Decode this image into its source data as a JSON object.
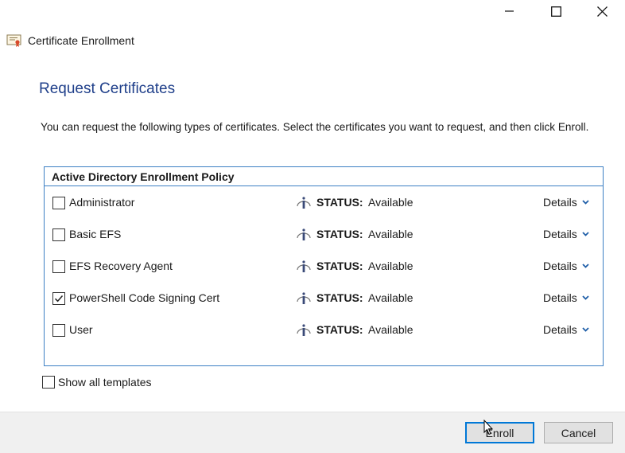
{
  "window": {
    "minimize_icon": "minimize-icon",
    "maximize_icon": "maximize-icon",
    "close_icon": "close-icon"
  },
  "header": {
    "title": "Certificate Enrollment",
    "icon": "certificate-icon"
  },
  "page": {
    "title": "Request Certificates",
    "instructions": "You can request the following types of certificates. Select the certificates you want to request, and then click Enroll."
  },
  "policy": {
    "title": "Active Directory Enrollment Policy",
    "status_label": "STATUS:",
    "details_label": "Details",
    "items": [
      {
        "name": "Administrator",
        "status": "Available",
        "checked": false
      },
      {
        "name": "Basic EFS",
        "status": "Available",
        "checked": false
      },
      {
        "name": "EFS Recovery Agent",
        "status": "Available",
        "checked": false
      },
      {
        "name": "PowerShell Code Signing Cert",
        "status": "Available",
        "checked": true
      },
      {
        "name": "User",
        "status": "Available",
        "checked": false
      }
    ]
  },
  "options": {
    "show_all_label": "Show all templates",
    "show_all_checked": false
  },
  "footer": {
    "enroll_label": "Enroll",
    "cancel_label": "Cancel"
  },
  "colors": {
    "title_blue": "#1f3f8a",
    "border_blue": "#3c7fc4",
    "focus_blue": "#0078d7",
    "footer_bg": "#f0f0f0"
  }
}
